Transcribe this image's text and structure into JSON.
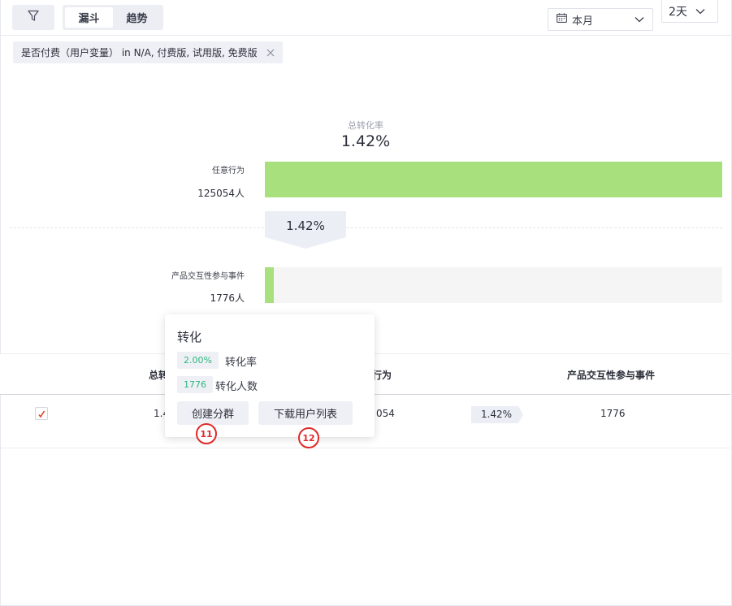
{
  "toolbar": {
    "tabs": [
      {
        "label": "漏斗",
        "active": true
      },
      {
        "label": "趋势",
        "active": false
      }
    ],
    "date_range": "本月",
    "granularity": "2天"
  },
  "filter": {
    "text": "是否付费（用户变量） in N/A, 付费版, 试用版, 免费版"
  },
  "funnel": {
    "overall_label": "总转化率",
    "overall_value": "1.42%",
    "steps": [
      {
        "name": "任意行为",
        "count": "125054人",
        "fill_fraction": 1.0
      },
      {
        "name": "产品交互性参与事件",
        "count": "1776人",
        "fill_fraction": 0.0142
      }
    ],
    "step_conversion": "1.42%"
  },
  "table": {
    "headers": {
      "total_partial": "总转",
      "step1_partial": "行为",
      "step2": "产品交互性参与事件"
    },
    "row": {
      "checked": true,
      "total_partial": "1.4",
      "step1_partial": "054",
      "rate": "1.42%",
      "step2": "1776"
    }
  },
  "popover": {
    "title": "转化",
    "rate_value": "2.00%",
    "rate_label": "转化率",
    "count_value": "1776",
    "count_label": "转化人数",
    "create_group_button": "创建分群",
    "download_button": "下载用户列表"
  },
  "markers": [
    "11",
    "12"
  ],
  "colors": {
    "bar_fill": "#a9e07e",
    "accent_green": "#2db87d",
    "marker_red": "#e02a2a"
  }
}
